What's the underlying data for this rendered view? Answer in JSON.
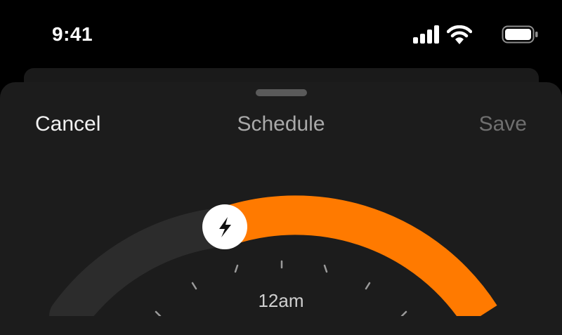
{
  "status_bar": {
    "time": "9:41",
    "icons": [
      "cellular-signal-icon",
      "wifi-icon",
      "battery-icon"
    ]
  },
  "sheet": {
    "nav": {
      "cancel_label": "Cancel",
      "title": "Schedule",
      "save_label": "Save"
    },
    "dial": {
      "hour_label": "12am",
      "handle_icon": "lightning-bolt-icon",
      "colors": {
        "active_arc": "#ff7a00",
        "inactive_arc": "#2c2c2c",
        "handle": "#ffffff",
        "handle_glyph": "#111111"
      }
    }
  }
}
